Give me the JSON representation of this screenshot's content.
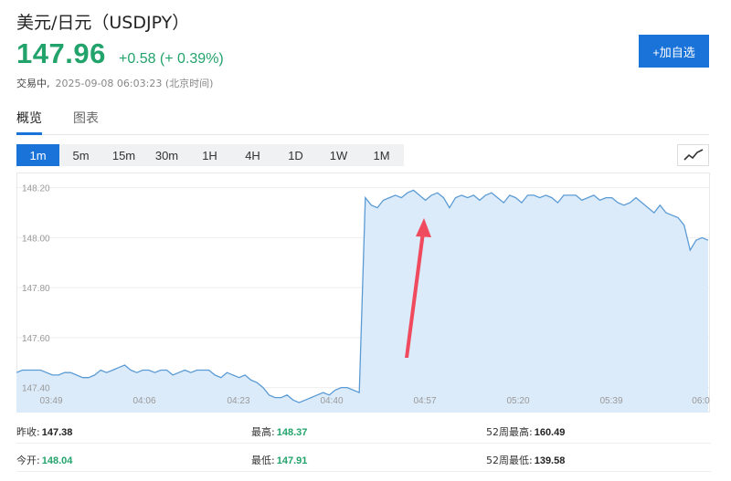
{
  "header": {
    "title": "美元/日元（USDJPY）",
    "price": "147.96",
    "change": "+0.58 (+ 0.39%)",
    "status": "交易中,",
    "timestamp": "2025-09-08 06:03:23 (北京时间)",
    "watch_button": "+加自选"
  },
  "tabs": [
    {
      "label": "概览",
      "active": true
    },
    {
      "label": "图表",
      "active": false
    }
  ],
  "intervals": [
    {
      "label": "1m",
      "active": true
    },
    {
      "label": "5m"
    },
    {
      "label": "15m"
    },
    {
      "label": "30m"
    },
    {
      "label": "1H"
    },
    {
      "label": "4H"
    },
    {
      "label": "1D"
    },
    {
      "label": "1W"
    },
    {
      "label": "1M"
    }
  ],
  "chart_type_icon": "line-chart-icon",
  "chart_data": {
    "type": "area",
    "ylim": [
      147.3,
      148.25
    ],
    "yticks": [
      "148.20",
      "148.00",
      "147.80",
      "147.60",
      "147.40"
    ],
    "xticks": [
      "03:49",
      "04:06",
      "04:23",
      "04:40",
      "04:57",
      "05:20",
      "05:39",
      "06:0"
    ],
    "values": [
      147.46,
      147.47,
      147.47,
      147.47,
      147.47,
      147.46,
      147.45,
      147.45,
      147.46,
      147.46,
      147.45,
      147.44,
      147.44,
      147.45,
      147.47,
      147.46,
      147.47,
      147.48,
      147.49,
      147.47,
      147.46,
      147.47,
      147.47,
      147.46,
      147.47,
      147.47,
      147.45,
      147.46,
      147.47,
      147.46,
      147.47,
      147.47,
      147.47,
      147.45,
      147.44,
      147.46,
      147.45,
      147.44,
      147.45,
      147.43,
      147.42,
      147.4,
      147.37,
      147.36,
      147.36,
      147.37,
      147.35,
      147.34,
      147.35,
      147.36,
      147.37,
      147.38,
      147.37,
      147.39,
      147.4,
      147.4,
      147.39,
      147.38,
      148.16,
      148.13,
      148.12,
      148.15,
      148.16,
      148.17,
      148.16,
      148.18,
      148.19,
      148.17,
      148.15,
      148.17,
      148.18,
      148.16,
      148.12,
      148.16,
      148.17,
      148.16,
      148.17,
      148.15,
      148.17,
      148.18,
      148.16,
      148.14,
      148.17,
      148.16,
      148.14,
      148.17,
      148.17,
      148.16,
      148.17,
      148.16,
      148.14,
      148.17,
      148.17,
      148.17,
      148.15,
      148.16,
      148.17,
      148.15,
      148.16,
      148.16,
      148.14,
      148.13,
      148.14,
      148.16,
      148.14,
      148.12,
      148.1,
      148.13,
      148.1,
      148.09,
      148.08,
      148.05,
      147.95,
      147.99,
      148.0,
      147.99
    ],
    "line_color": "#5b9bd5",
    "fill_color": "#dcebfa",
    "annotation": "red-arrow-up"
  },
  "stats": [
    {
      "label": "昨收:",
      "value": "147.38",
      "tone": "dark"
    },
    {
      "label": "最高:",
      "value": "148.37",
      "tone": "green"
    },
    {
      "label": "52周最高:",
      "value": "160.49",
      "tone": "dark"
    },
    {
      "label": "今开:",
      "value": "148.04",
      "tone": "green"
    },
    {
      "label": "最低:",
      "value": "147.91",
      "tone": "green"
    },
    {
      "label": "52周最低:",
      "value": "139.58",
      "tone": "dark"
    }
  ]
}
